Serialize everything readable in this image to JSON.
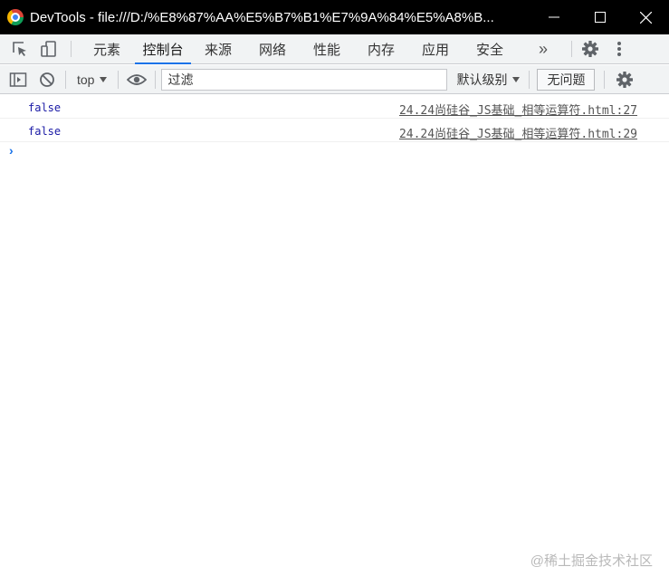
{
  "window": {
    "title": "DevTools - file:///D:/%E8%87%AA%E5%B7%B1%E7%9A%84%E5%A8%B..."
  },
  "tabs": [
    {
      "label": "元素",
      "active": false
    },
    {
      "label": "控制台",
      "active": true
    },
    {
      "label": "来源",
      "active": false
    },
    {
      "label": "网络",
      "active": false
    },
    {
      "label": "性能",
      "active": false
    },
    {
      "label": "内存",
      "active": false
    },
    {
      "label": "应用",
      "active": false
    },
    {
      "label": "安全",
      "active": false
    }
  ],
  "more_tabs_glyph": "»",
  "toolbar": {
    "context": "top",
    "filter_placeholder": "过滤",
    "levels_label": "默认级别",
    "issues_label": "无问题"
  },
  "console": {
    "messages": [
      {
        "value": "false",
        "source": "24.24尚硅谷_JS基础_相等运算符.html:27"
      },
      {
        "value": "false",
        "source": "24.24尚硅谷_JS基础_相等运算符.html:29"
      }
    ],
    "prompt_glyph": "›"
  },
  "watermark": "@稀土掘金技术社区",
  "colors": {
    "accent": "#1a73e8",
    "boolean_value": "#1a1aa6",
    "titlebar": "#000000",
    "toolbar_bg": "#f1f3f4"
  }
}
